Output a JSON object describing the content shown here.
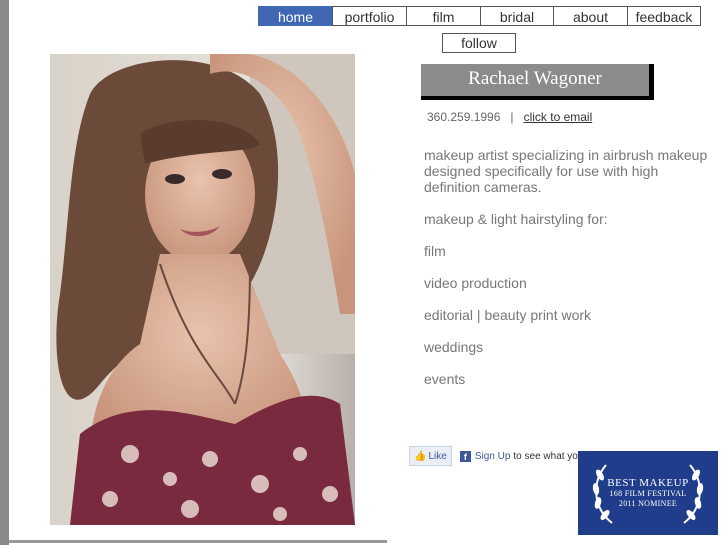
{
  "nav": {
    "items": [
      {
        "label": "home"
      },
      {
        "label": "portfolio"
      },
      {
        "label": "film"
      },
      {
        "label": "bridal"
      },
      {
        "label": "about"
      },
      {
        "label": "feedback"
      }
    ],
    "follow_label": "follow"
  },
  "profile": {
    "name": "Rachael Wagoner",
    "phone": "360.259.1996",
    "separator": "|",
    "email_link": "click to email"
  },
  "bio": {
    "intro": "makeup artist specializing in airbrush makeup designed specifically for use with high definition cameras.",
    "services_heading": "makeup & light hairstyling for:",
    "services": [
      "film",
      "video production",
      "editorial | beauty print work",
      "weddings",
      "events"
    ]
  },
  "facebook": {
    "like_label": "Like",
    "signup_label": "Sign Up",
    "signup_rest": "to see what yo"
  },
  "award": {
    "title": "BEST MAKEUP",
    "festival": "168 FILM FESTIVAL",
    "nominee": "2011 NOMINEE"
  },
  "colors": {
    "nav_active": "#3f67b3",
    "award_bg": "#1f3d8a",
    "banner_bg": "#8b8b8b"
  }
}
